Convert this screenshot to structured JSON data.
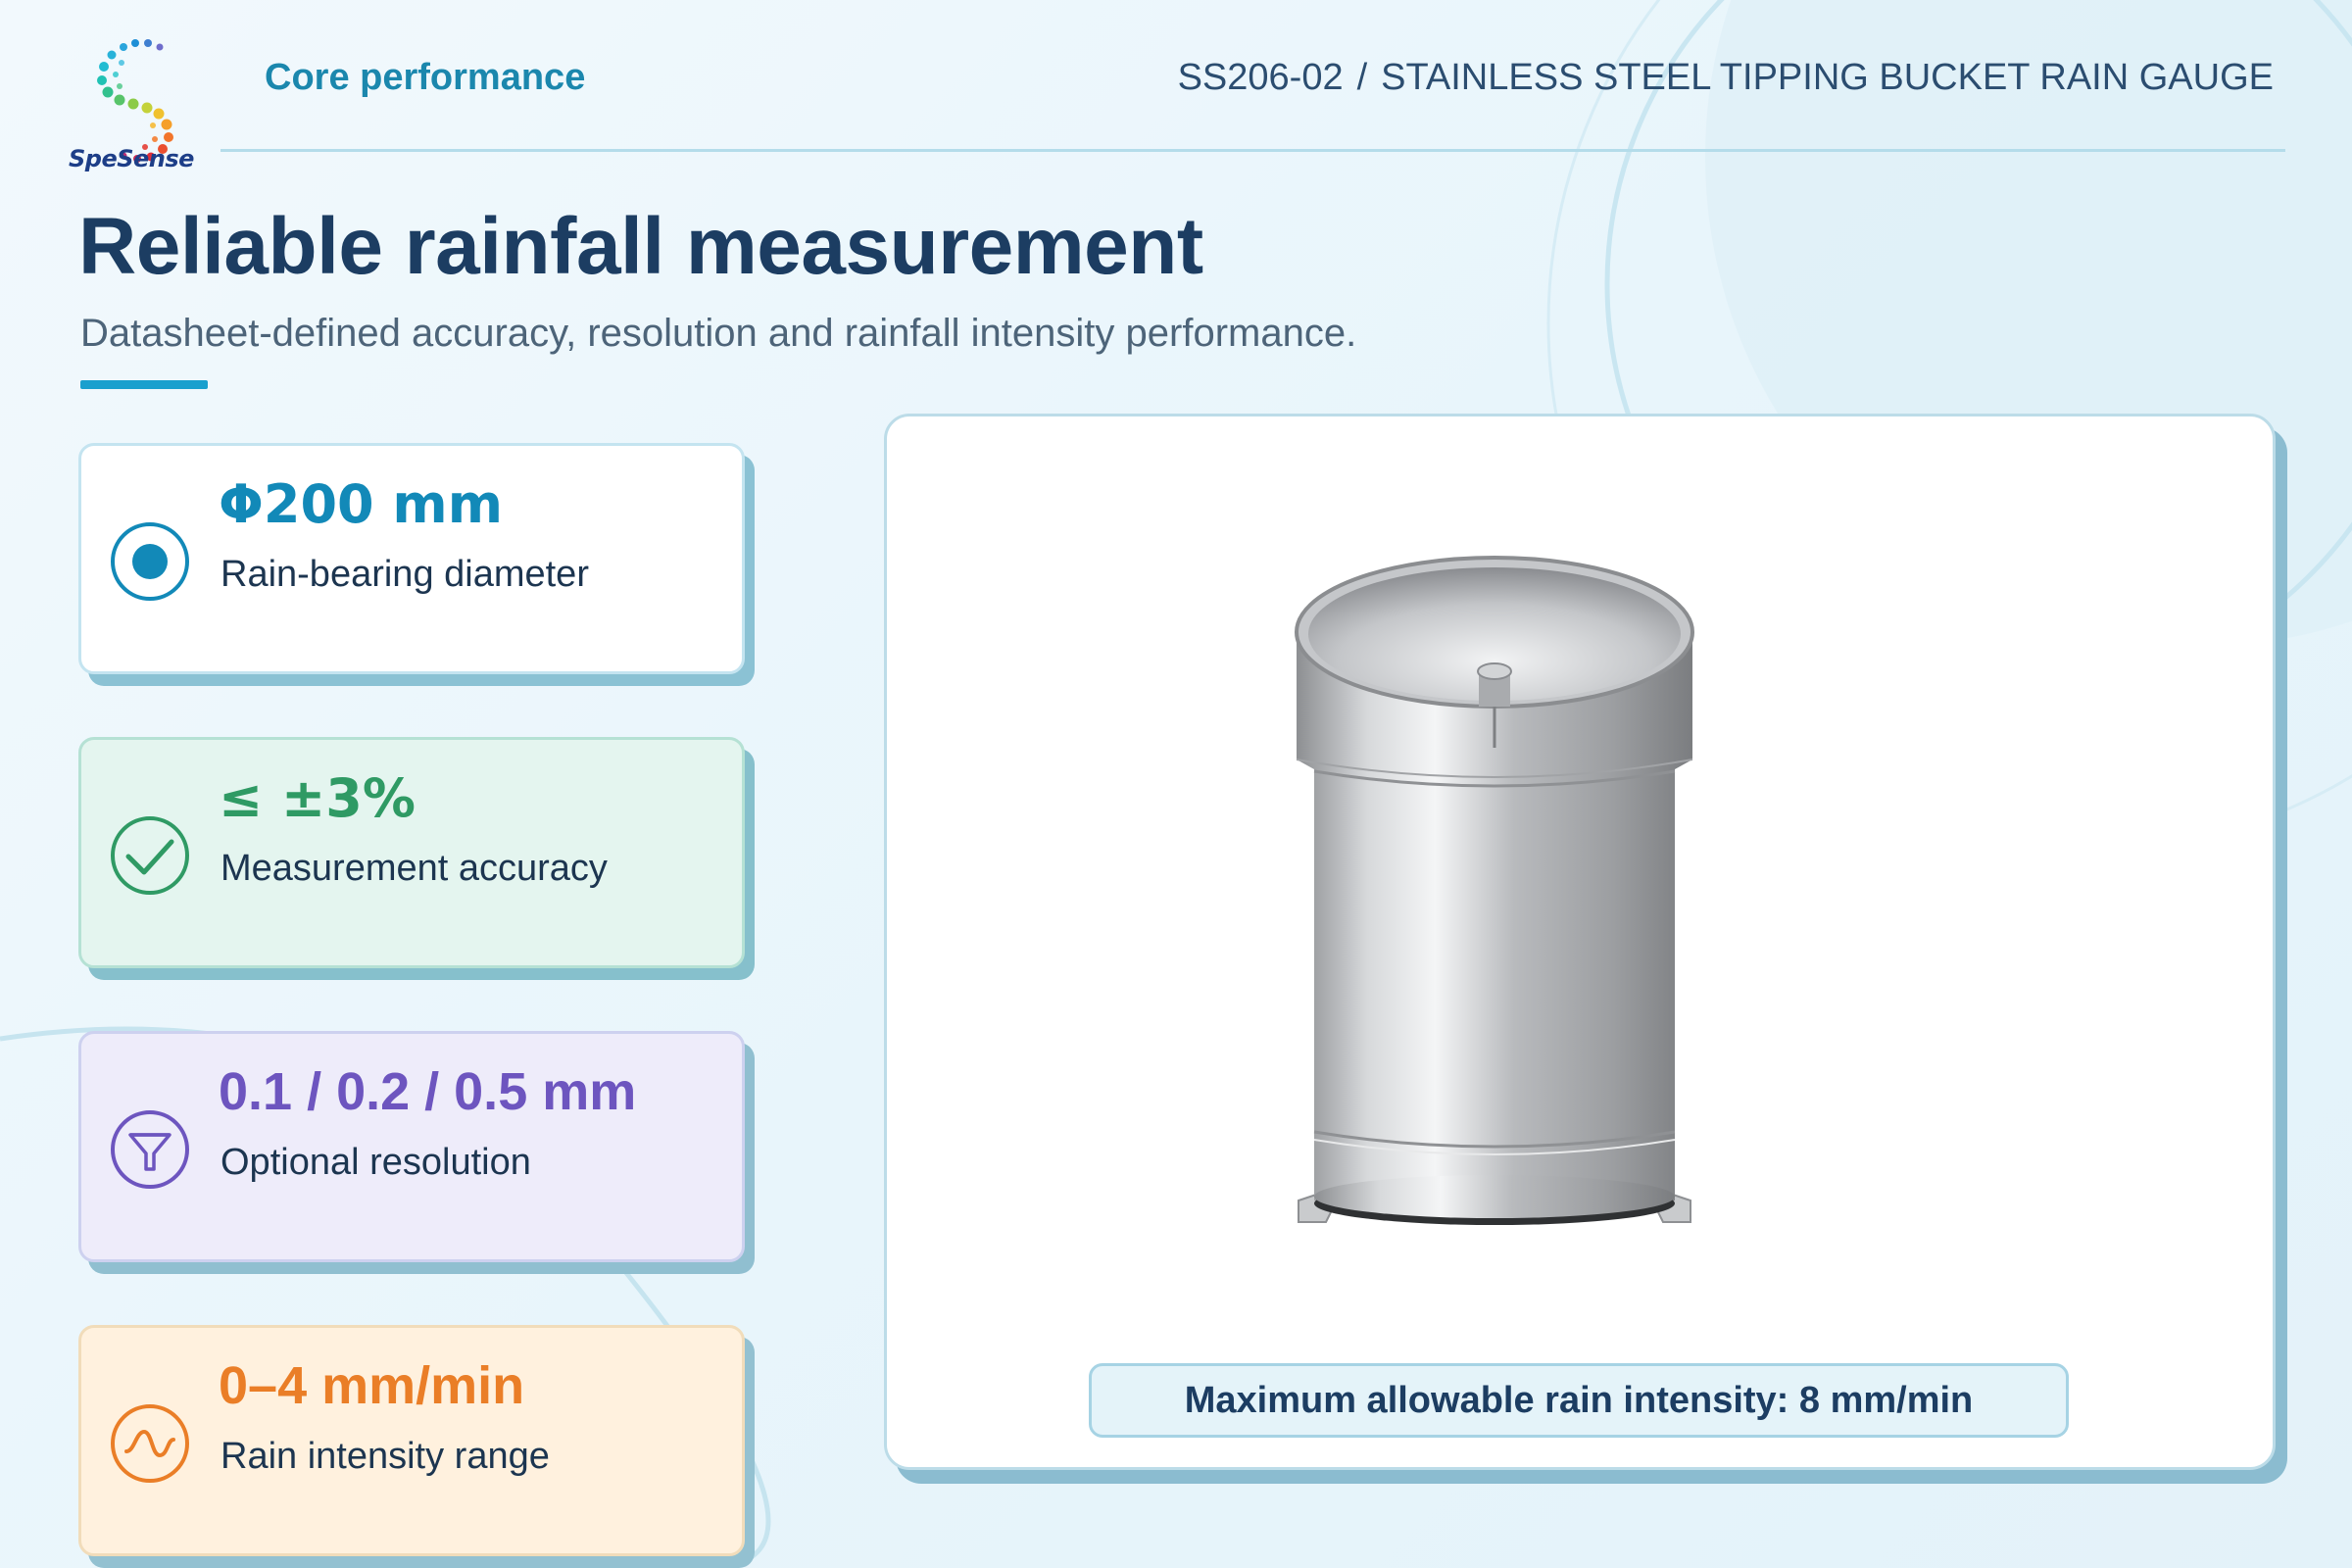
{
  "header": {
    "brand_name": "SpeSense",
    "section_label": "Core performance",
    "model": "SS206-02",
    "separator": "/",
    "product_name": "STAINLESS STEEL TIPPING BUCKET RAIN GAUGE"
  },
  "hero": {
    "title": "Reliable rainfall measurement",
    "subtitle": "Datasheet-defined accuracy, resolution and rainfall intensity performance."
  },
  "specs": [
    {
      "value": "Φ200 mm",
      "label": "Rain-bearing diameter",
      "icon": "target-icon",
      "color": "#1289b8"
    },
    {
      "value": "≤ ±3%",
      "label": "Measurement accuracy",
      "icon": "check-circle-icon",
      "color": "#2f9a64"
    },
    {
      "value": "0.1 / 0.2 / 0.5 mm",
      "label": "Optional resolution",
      "icon": "funnel-icon",
      "color": "#6d55bf"
    },
    {
      "value": "0–4 mm/min",
      "label": "Rain intensity range",
      "icon": "wave-icon",
      "color": "#ea7e27"
    }
  ],
  "product_image": {
    "caption": "Maximum allowable rain intensity: 8 mm/min"
  },
  "colors": {
    "title": "#1c3d62",
    "accent": "#1aa0ce",
    "section_label": "#1b87ad"
  }
}
